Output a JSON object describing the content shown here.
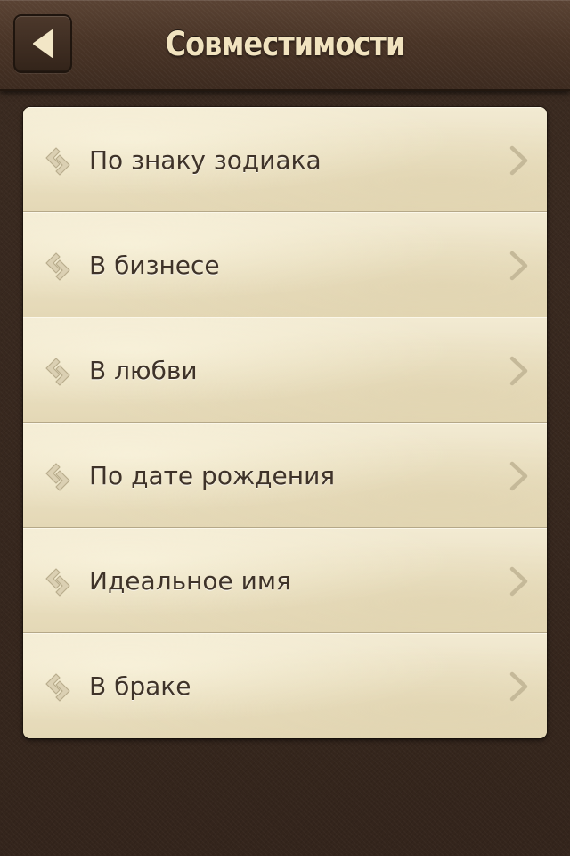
{
  "header": {
    "title": "Совместимости",
    "back_icon": "back-arrow-icon"
  },
  "colors": {
    "header_background": "#4a3527",
    "title_text": "#f1e3bf",
    "page_background": "#3a2a20",
    "list_background": "#ece2c4",
    "item_text": "#3f3329",
    "separator": "#b5a888"
  },
  "menu": {
    "items": [
      {
        "label": "По знаку зодиака",
        "icon": "compatibility-arrows-icon"
      },
      {
        "label": "В бизнесе",
        "icon": "compatibility-arrows-icon"
      },
      {
        "label": "В любви",
        "icon": "compatibility-arrows-icon"
      },
      {
        "label": "По дате рождения",
        "icon": "compatibility-arrows-icon"
      },
      {
        "label": "Идеальное имя",
        "icon": "compatibility-arrows-icon"
      },
      {
        "label": "В браке",
        "icon": "compatibility-arrows-icon"
      }
    ]
  }
}
